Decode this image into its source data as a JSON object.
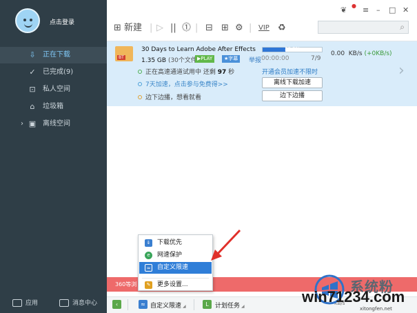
{
  "sidebar": {
    "login_text": "点击登录",
    "items": [
      {
        "icon": "download-icon",
        "glyph": "⇩",
        "label": "正在下载"
      },
      {
        "icon": "check-circle-icon",
        "glyph": "✓",
        "label": "已完成(9)"
      },
      {
        "icon": "lock-icon",
        "glyph": "⊡",
        "label": "私人空间"
      },
      {
        "icon": "trash-icon",
        "glyph": "⌂",
        "label": "垃圾箱"
      },
      {
        "icon": "cloud-folder-icon",
        "glyph": "▣",
        "label": "离线空间"
      }
    ],
    "bottom_app": "应用",
    "bottom_msg": "消息中心"
  },
  "toolbar": {
    "new_label": "新建",
    "vip_label": "VIP",
    "search_placeholder": ""
  },
  "download": {
    "filename": "30 Days to Learn Adobe After Effects",
    "size": "1.35 GB",
    "file_count": "(30个文件)",
    "play_tag": "▶PLAY",
    "sub_tag": "★字幕",
    "report": "举报",
    "elapsed": "00:00:00",
    "progress_label": "38.9%",
    "progress_value": 38.9,
    "piece_count": "7/9",
    "speed": "0.00",
    "speed_unit": "KB/s",
    "speed_up": "(+0KB/s)",
    "trial_prefix": "正在高速通道试用中  还剩 ",
    "trial_num": "97",
    "trial_suffix": " 秒",
    "promo": "7天加速，点击参与免费得>>",
    "side_play": "边下边播，想看就看",
    "vip_link": "开通会员加速不限时",
    "btn_offline": "离线下载加速",
    "btn_play": "边下边播"
  },
  "notice": {
    "text": "360等浏"
  },
  "status": {
    "limit_label": "自定义限速",
    "task_label": "计划任务",
    "speed_label": "KB/s"
  },
  "menu": {
    "items": [
      {
        "label": "下载优先",
        "icon": "download-priority-icon",
        "color": "#3a7fd0"
      },
      {
        "label": "网速保护",
        "icon": "shield-icon",
        "color": "#3aa55a"
      },
      {
        "label": "自定义限速",
        "icon": "limit-speed-icon",
        "color": "#3a7fd0"
      },
      {
        "label": "更多设置...",
        "icon": "wrench-icon",
        "color": "#e0a020"
      }
    ]
  },
  "watermark": {
    "brand": "系统粉",
    "url": "win71234.com",
    "net": "xitongfen.net"
  },
  "colors": {
    "sidebar": "#2f3e47",
    "accent": "#2f7ed8",
    "notice": "#ee6a6a",
    "row_bg": "#d9ecfa"
  }
}
